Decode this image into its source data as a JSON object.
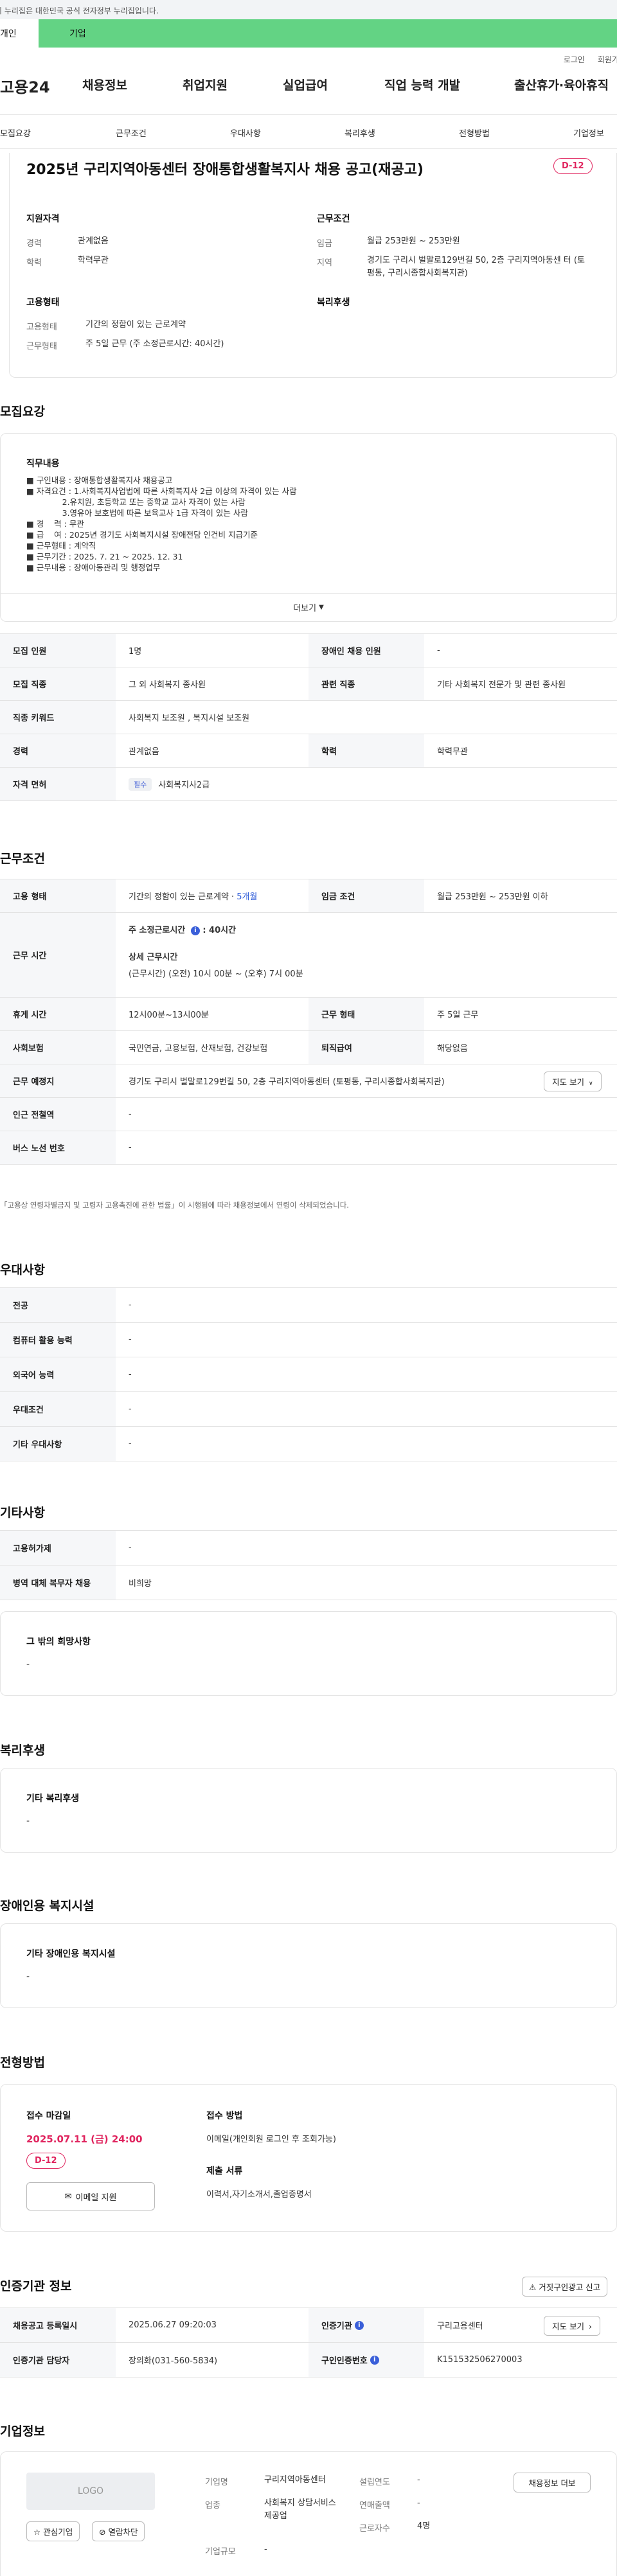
{
  "gov_banner": "이 누리집은 대한민국 공식 전자정부 누리집입니다.",
  "top_tabs": {
    "individual": "개인",
    "company": "기업"
  },
  "util_links": {
    "login": "로그인",
    "signup": "회원가입"
  },
  "gnb": {
    "logo": "고용24",
    "menus": [
      "채용정보",
      "취업지원",
      "실업급여",
      "직업 능력 개발",
      "출산휴가·육아휴직"
    ]
  },
  "subnav": [
    "모집요강",
    "근무조건",
    "우대사항",
    "복리후생",
    "전형방법",
    "기업정보"
  ],
  "job": {
    "title": "2025년 구리지역아동센터 장애통합생활복지사 채용 공고(재공고)",
    "dday": "D-12",
    "qualification_title": "지원자격",
    "qualification": [
      {
        "k": "경력",
        "v": "관계없음"
      },
      {
        "k": "학력",
        "v": "학력무관"
      }
    ],
    "conditions_title": "근무조건",
    "conditions": [
      {
        "k": "임금",
        "v": "월급 253만원 ~ 253만원"
      },
      {
        "k": "지역",
        "v": "경기도 구리시 벌말로129번길 50, 2층 구리지역아동센 터 (토평동, 구리시종합사회복지관)"
      }
    ],
    "employment_title": "고용형태",
    "employment": [
      {
        "k": "고용형태",
        "v": "기간의 정함이 있는 근로계약"
      },
      {
        "k": "근무형태",
        "v": "주 5일 근무 (주 소정근로시간: 40시간)"
      }
    ],
    "welfare_title": "복리후생"
  },
  "recruit": {
    "section_title": "모집요강",
    "duty_title": "직무내용",
    "duty_lines": [
      "■ 구인내용 : 장애통합생활복지사 채용공고",
      "■ 자격요건 : 1.사회복지사업법에 따른 사회복지사 2급 이상의 자격이 있는 사람",
      "              2.유치원, 초등학교 또는 중학교 교사 자격이 있는 사람",
      "              3.영유아 보호법에 따른 보육교사 1급 자격이 있는 사람",
      "■ 경    력 : 무관",
      "■ 급    여 : 2025년 경기도 사회복지시설 장애전담 인건비 지급기준",
      "■ 근무형태 : 계약직",
      "■ 근무기간 : 2025. 7. 21 ~ 2025. 12. 31",
      "■ 근무내용 : 장애아동관리 및 행정업무"
    ],
    "more": "더보기",
    "rows": {
      "headcount_k": "모집 인원",
      "headcount_v": "1명",
      "disabled_k": "장애인 채용 인원",
      "disabled_v": "-",
      "job_k": "모집 직종",
      "job_v": "그 외 사회복지 종사원",
      "related_k": "관련 직종",
      "related_v": "기타 사회복지 전문가 및 관련 종사원",
      "keyword_k": "직종 키워드",
      "keyword_v": "사회복지 보조원 , 복지시설 보조원",
      "career_k": "경력",
      "career_v": "관계없음",
      "edu_k": "학력",
      "edu_v": "학력무관",
      "license_k": "자격 면허",
      "license_badge": "필수",
      "license_v": "사회복지사2급"
    }
  },
  "work": {
    "section_title": "근무조건",
    "type_k": "고용 형태",
    "type_v": "기간의 정함이 있는 근로계약 · ",
    "type_link": "5개월",
    "wage_k": "임금 조건",
    "wage_v": "월급 253만원 ~ 253만원 이하",
    "hours_k": "근무 시간",
    "hours_main": "주 소정근로시간",
    "hours_main_v": ": 40시간",
    "hours_detail_title": "상세 근무시간",
    "hours_detail": "(근무시간) (오전) 10시 00분 ~ (오후) 7시 00분",
    "break_k": "휴게 시간",
    "break_v": "12시00분~13시00분",
    "form_k": "근무 형태",
    "form_v": "주 5일 근무",
    "insurance_k": "사회보험",
    "insurance_v": "국민연금, 고용보험, 산재보험, 건강보험",
    "retire_k": "퇴직급여",
    "retire_v": "해당없음",
    "place_k": "근무 예정지",
    "place_v": "경기도 구리시 벌말로129번길 50, 2층 구리지역아동센터 (토평동, 구리시종합사회복지관)",
    "map_btn": "지도 보기",
    "station_k": "인근 전철역",
    "station_v": "-",
    "bus_k": "버스 노선 번호",
    "bus_v": "-",
    "note": "「고용상 연령차별금지 및 고령자 고용촉진에 관한 법률」이 시행됨에 따라 채용정보에서 연령이 삭제되었습니다."
  },
  "pref": {
    "section_title": "우대사항",
    "rows": [
      {
        "k": "전공",
        "v": "-"
      },
      {
        "k": "컴퓨터 활용 능력",
        "v": "-"
      },
      {
        "k": "외국어 능력",
        "v": "-"
      },
      {
        "k": "우대조건",
        "v": "-"
      },
      {
        "k": "기타 우대사항",
        "v": "-"
      }
    ]
  },
  "etc": {
    "section_title": "기타사항",
    "rows": [
      {
        "k": "고용허가제",
        "v": "-"
      },
      {
        "k": "병역 대체 복무자 채용",
        "v": "비희망"
      }
    ],
    "box_title": "그 밖의 희망사항",
    "box_val": "-"
  },
  "welfare": {
    "section_title": "복리후생",
    "box_title": "기타 복리후생",
    "box_val": "-"
  },
  "disabled": {
    "section_title": "장애인용 복지시설",
    "box_title": "기타 장애인용 복지시설",
    "box_val": "-"
  },
  "screening": {
    "section_title": "전형방법",
    "deadline_title": "접수 마감일",
    "deadline": "2025.07.11 (금) 24:00",
    "dday": "D-12",
    "email_btn": "이메일 지원",
    "method_title": "접수 방법",
    "method_v": "이메일(개인회원 로그인 후 조회가능)",
    "docs_title": "제출 서류",
    "docs_v": "이력서,자기소개서,졸업증명서"
  },
  "agency": {
    "section_title": "인증기관 정보",
    "report_btn": "거짓구인광고 신고",
    "reg_k": "채용공고 등록일시",
    "reg_v": "2025.06.27 09:20:03",
    "org_k": "인증기관",
    "org_v": "구리고용센터",
    "org_btn": "지도 보기",
    "manager_k": "인증기관 담당자",
    "manager_v": "장의화(031-560-5834)",
    "auth_k": "구인인증번호",
    "auth_v": "K151532506270003"
  },
  "company": {
    "section_title": "기업정보",
    "logo": "LOGO",
    "fav_btn": "관심기업",
    "block_btn": "열람차단",
    "name_k": "기업명",
    "name_v": "구리지역아동센터",
    "year_k": "설립연도",
    "year_v": "-",
    "biz_k": "업종",
    "biz_v": "사회복지 상담서비스 제공업",
    "sales_k": "연매출액",
    "sales_v": "-",
    "staff_k": "근로자수",
    "staff_v": "4명",
    "size_k": "기업규모",
    "size_v": "-",
    "jobs_btn": "채용정보 더보"
  }
}
